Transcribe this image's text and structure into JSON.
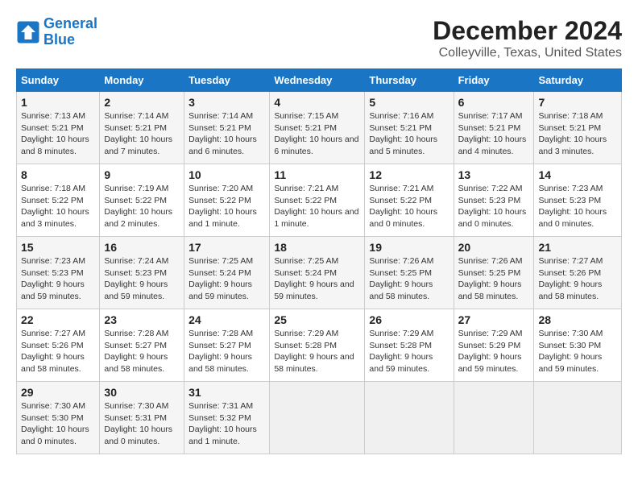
{
  "logo": {
    "line1": "General",
    "line2": "Blue"
  },
  "title": "December 2024",
  "subtitle": "Colleyville, Texas, United States",
  "weekdays": [
    "Sunday",
    "Monday",
    "Tuesday",
    "Wednesday",
    "Thursday",
    "Friday",
    "Saturday"
  ],
  "weeks": [
    [
      {
        "day": 1,
        "sunrise": "7:13 AM",
        "sunset": "5:21 PM",
        "daylight": "10 hours and 8 minutes."
      },
      {
        "day": 2,
        "sunrise": "7:14 AM",
        "sunset": "5:21 PM",
        "daylight": "10 hours and 7 minutes."
      },
      {
        "day": 3,
        "sunrise": "7:14 AM",
        "sunset": "5:21 PM",
        "daylight": "10 hours and 6 minutes."
      },
      {
        "day": 4,
        "sunrise": "7:15 AM",
        "sunset": "5:21 PM",
        "daylight": "10 hours and 6 minutes."
      },
      {
        "day": 5,
        "sunrise": "7:16 AM",
        "sunset": "5:21 PM",
        "daylight": "10 hours and 5 minutes."
      },
      {
        "day": 6,
        "sunrise": "7:17 AM",
        "sunset": "5:21 PM",
        "daylight": "10 hours and 4 minutes."
      },
      {
        "day": 7,
        "sunrise": "7:18 AM",
        "sunset": "5:21 PM",
        "daylight": "10 hours and 3 minutes."
      }
    ],
    [
      {
        "day": 8,
        "sunrise": "7:18 AM",
        "sunset": "5:22 PM",
        "daylight": "10 hours and 3 minutes."
      },
      {
        "day": 9,
        "sunrise": "7:19 AM",
        "sunset": "5:22 PM",
        "daylight": "10 hours and 2 minutes."
      },
      {
        "day": 10,
        "sunrise": "7:20 AM",
        "sunset": "5:22 PM",
        "daylight": "10 hours and 1 minute."
      },
      {
        "day": 11,
        "sunrise": "7:21 AM",
        "sunset": "5:22 PM",
        "daylight": "10 hours and 1 minute."
      },
      {
        "day": 12,
        "sunrise": "7:21 AM",
        "sunset": "5:22 PM",
        "daylight": "10 hours and 0 minutes."
      },
      {
        "day": 13,
        "sunrise": "7:22 AM",
        "sunset": "5:23 PM",
        "daylight": "10 hours and 0 minutes."
      },
      {
        "day": 14,
        "sunrise": "7:23 AM",
        "sunset": "5:23 PM",
        "daylight": "10 hours and 0 minutes."
      }
    ],
    [
      {
        "day": 15,
        "sunrise": "7:23 AM",
        "sunset": "5:23 PM",
        "daylight": "9 hours and 59 minutes."
      },
      {
        "day": 16,
        "sunrise": "7:24 AM",
        "sunset": "5:23 PM",
        "daylight": "9 hours and 59 minutes."
      },
      {
        "day": 17,
        "sunrise": "7:25 AM",
        "sunset": "5:24 PM",
        "daylight": "9 hours and 59 minutes."
      },
      {
        "day": 18,
        "sunrise": "7:25 AM",
        "sunset": "5:24 PM",
        "daylight": "9 hours and 59 minutes."
      },
      {
        "day": 19,
        "sunrise": "7:26 AM",
        "sunset": "5:25 PM",
        "daylight": "9 hours and 58 minutes."
      },
      {
        "day": 20,
        "sunrise": "7:26 AM",
        "sunset": "5:25 PM",
        "daylight": "9 hours and 58 minutes."
      },
      {
        "day": 21,
        "sunrise": "7:27 AM",
        "sunset": "5:26 PM",
        "daylight": "9 hours and 58 minutes."
      }
    ],
    [
      {
        "day": 22,
        "sunrise": "7:27 AM",
        "sunset": "5:26 PM",
        "daylight": "9 hours and 58 minutes."
      },
      {
        "day": 23,
        "sunrise": "7:28 AM",
        "sunset": "5:27 PM",
        "daylight": "9 hours and 58 minutes."
      },
      {
        "day": 24,
        "sunrise": "7:28 AM",
        "sunset": "5:27 PM",
        "daylight": "9 hours and 58 minutes."
      },
      {
        "day": 25,
        "sunrise": "7:29 AM",
        "sunset": "5:28 PM",
        "daylight": "9 hours and 58 minutes."
      },
      {
        "day": 26,
        "sunrise": "7:29 AM",
        "sunset": "5:28 PM",
        "daylight": "9 hours and 59 minutes."
      },
      {
        "day": 27,
        "sunrise": "7:29 AM",
        "sunset": "5:29 PM",
        "daylight": "9 hours and 59 minutes."
      },
      {
        "day": 28,
        "sunrise": "7:30 AM",
        "sunset": "5:30 PM",
        "daylight": "9 hours and 59 minutes."
      }
    ],
    [
      {
        "day": 29,
        "sunrise": "7:30 AM",
        "sunset": "5:30 PM",
        "daylight": "10 hours and 0 minutes."
      },
      {
        "day": 30,
        "sunrise": "7:30 AM",
        "sunset": "5:31 PM",
        "daylight": "10 hours and 0 minutes."
      },
      {
        "day": 31,
        "sunrise": "7:31 AM",
        "sunset": "5:32 PM",
        "daylight": "10 hours and 1 minute."
      },
      null,
      null,
      null,
      null
    ]
  ]
}
